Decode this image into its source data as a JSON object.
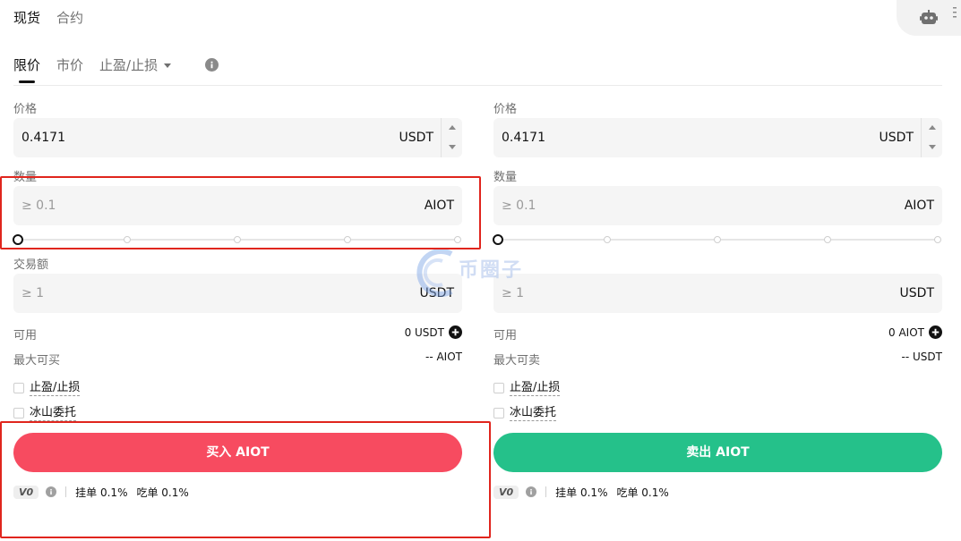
{
  "top_tabs": [
    {
      "label": "现货",
      "active": true
    },
    {
      "label": "合约",
      "active": false
    }
  ],
  "order_tabs": [
    {
      "label": "限价",
      "active": true
    },
    {
      "label": "市价",
      "active": false
    },
    {
      "label": "止盈/止损",
      "active": false,
      "dropdown": true
    }
  ],
  "icons": {
    "robot": "robot-icon",
    "menu": "more-vertical-icon",
    "info": "info-icon",
    "plus": "plus-circle-icon"
  },
  "buy": {
    "price_label": "价格",
    "price_value": "0.4171",
    "price_unit": "USDT",
    "amount_label": "数量",
    "amount_placeholder": "≥ 0.1",
    "amount_unit": "AIOT",
    "slider_percent": 0,
    "total_label": "交易额",
    "total_placeholder": "≥ 1",
    "total_unit": "USDT",
    "available_label": "可用",
    "available_value": "0 USDT",
    "max_label": "最大可买",
    "max_value": "-- AIOT",
    "tpsl_label": "止盈/止损",
    "iceberg_label": "冰山委托",
    "button_label": "买入 AIOT"
  },
  "sell": {
    "price_label": "价格",
    "price_value": "0.4171",
    "price_unit": "USDT",
    "amount_label": "数量",
    "amount_placeholder": "≥ 0.1",
    "amount_unit": "AIOT",
    "slider_percent": 0,
    "total_placeholder": "≥ 1",
    "total_unit": "USDT",
    "available_label": "可用",
    "available_value": "0 AIOT",
    "max_label": "最大可卖",
    "max_value": "-- USDT",
    "tpsl_label": "止盈/止损",
    "iceberg_label": "冰山委托",
    "button_label": "卖出 AIOT"
  },
  "fees": {
    "vip_level": "V0",
    "maker": "挂单 0.1%",
    "taker": "吃单 0.1%"
  },
  "watermark": "币圈子",
  "colors": {
    "buy": "#f74b60",
    "sell": "#25c18a",
    "highlight": "#e0251d"
  }
}
